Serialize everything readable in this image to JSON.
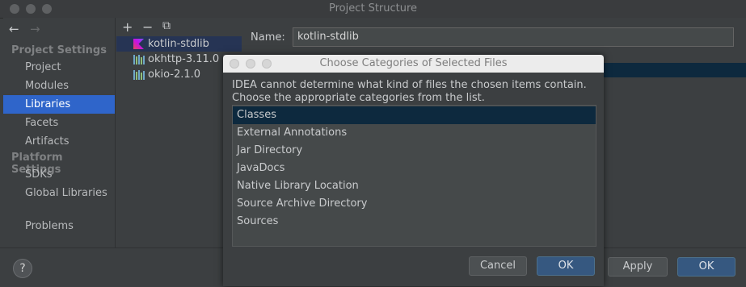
{
  "window": {
    "title": "Project Structure"
  },
  "nav": {
    "back": "←",
    "forward": "→",
    "project_settings_header": "Project Settings",
    "project_settings_items": [
      "Project",
      "Modules",
      "Libraries",
      "Facets",
      "Artifacts"
    ],
    "platform_settings_header": "Platform Settings",
    "platform_settings_items": [
      "SDKs",
      "Global Libraries"
    ],
    "problems": "Problems",
    "selected": "Libraries"
  },
  "libraries": {
    "toolbar": {
      "add": "+",
      "remove": "−",
      "copy": "⧉"
    },
    "items": [
      "kotlin-stdlib",
      "okhttp-3.11.0",
      "okio-2.1.0"
    ],
    "selected": "kotlin-stdlib"
  },
  "details": {
    "name_label": "Name:",
    "name_value": "kotlin-stdlib"
  },
  "bottom": {
    "help": "?",
    "apply": "Apply",
    "ok": "OK"
  },
  "dialog": {
    "title": "Choose Categories of Selected Files",
    "message_line1": "IDEA cannot determine what kind of files the chosen items contain.",
    "message_line2": "Choose the appropriate categories from the list.",
    "categories": [
      "Classes",
      "External Annotations",
      "Jar Directory",
      "JavaDocs",
      "Native Library Location",
      "Source Archive Directory",
      "Sources"
    ],
    "selected": "Classes",
    "cancel": "Cancel",
    "ok": "OK"
  },
  "colors": {
    "background": "#3c3f41",
    "selection_blue": "#2f65ca",
    "list_selection": "#0d293e",
    "default_button": "#365880",
    "kotlin_icon": "#7f52ff"
  }
}
